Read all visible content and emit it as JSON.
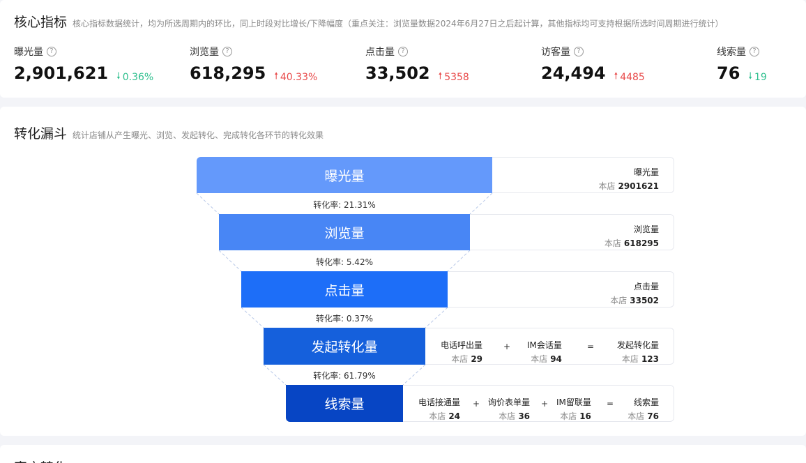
{
  "core": {
    "title": "核心指标",
    "desc": "核心指标数据统计，均为所选周期内的环比，同上时段对比增长/下降幅度（重点关注：浏览量数据2024年6月27日之后起计算，其他指标均可支持根据所选时间周期进行统计）",
    "metrics": [
      {
        "label": "曝光量",
        "value": "2,901,621",
        "change": "0.36%",
        "dir": "down"
      },
      {
        "label": "浏览量",
        "value": "618,295",
        "change": "40.33%",
        "dir": "up"
      },
      {
        "label": "点击量",
        "value": "33,502",
        "change": "5358",
        "dir": "up"
      },
      {
        "label": "访客量",
        "value": "24,494",
        "change": "4485",
        "dir": "up"
      },
      {
        "label": "线索量",
        "value": "76",
        "change": "19",
        "dir": "down"
      }
    ]
  },
  "funnel": {
    "title": "转化漏斗",
    "desc": "统计店铺从产生曝光、浏览、发起转化、完成转化各环节的转化效果",
    "store_label": "本店",
    "stages": [
      {
        "label": "曝光量",
        "color": "#6499fb"
      },
      {
        "label": "浏览量",
        "color": "#4886f5"
      },
      {
        "label": "点击量",
        "color": "#1d6ef8"
      },
      {
        "label": "发起转化量",
        "color": "#1560dc"
      },
      {
        "label": "线索量",
        "color": "#0745c4"
      }
    ],
    "rates": [
      "转化率: 21.31%",
      "转化率: 5.42%",
      "转化率: 0.37%",
      "转化率: 61.79%"
    ],
    "info": {
      "exposure": {
        "name": "曝光量",
        "value": "2901621"
      },
      "views": {
        "name": "浏览量",
        "value": "618295"
      },
      "clicks": {
        "name": "点击量",
        "value": "33502"
      },
      "initiate": [
        {
          "name": "电话呼出量",
          "value": "29"
        },
        {
          "name": "IM会话量",
          "value": "94"
        },
        {
          "name": "发起转化量",
          "value": "123"
        }
      ],
      "leads": [
        {
          "name": "电话接通量",
          "value": "24"
        },
        {
          "name": "询价表单量",
          "value": "36"
        },
        {
          "name": "IM留联量",
          "value": "16"
        },
        {
          "name": "线索量",
          "value": "76"
        }
      ]
    },
    "ops": {
      "plus": "+",
      "equals": "="
    }
  },
  "next_section": {
    "title": "客户转化"
  }
}
